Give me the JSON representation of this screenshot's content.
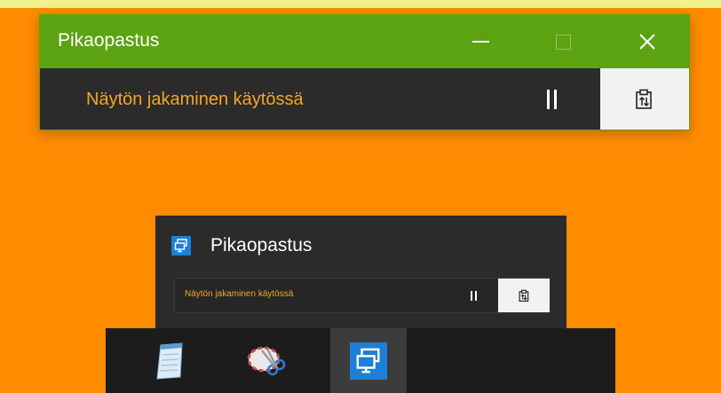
{
  "main_window": {
    "title": "Pikaopastus",
    "status_text": "Näytön jakaminen käytössä",
    "controls": {
      "minimize": "minimize-icon",
      "maximize": "maximize-icon",
      "close": "close-icon"
    },
    "pause_icon": "pause-icon",
    "clipboard_icon": "clipboard-sync-icon"
  },
  "preview": {
    "app_icon": "quick-assist-icon",
    "title": "Pikaopastus",
    "status_text": "Näytön jakaminen käytössä"
  },
  "taskbar": {
    "items": [
      {
        "icon": "notepad-icon"
      },
      {
        "icon": "snipping-tool-icon"
      },
      {
        "icon": "quick-assist-icon",
        "active": true
      }
    ]
  },
  "colors": {
    "desktop": "#FF8C00",
    "titlebar": "#5CA311",
    "window_body": "#2B2B2B",
    "status_text": "#F5A623",
    "taskbar": "#1C1C1C",
    "app_accent": "#1E7FD6"
  }
}
